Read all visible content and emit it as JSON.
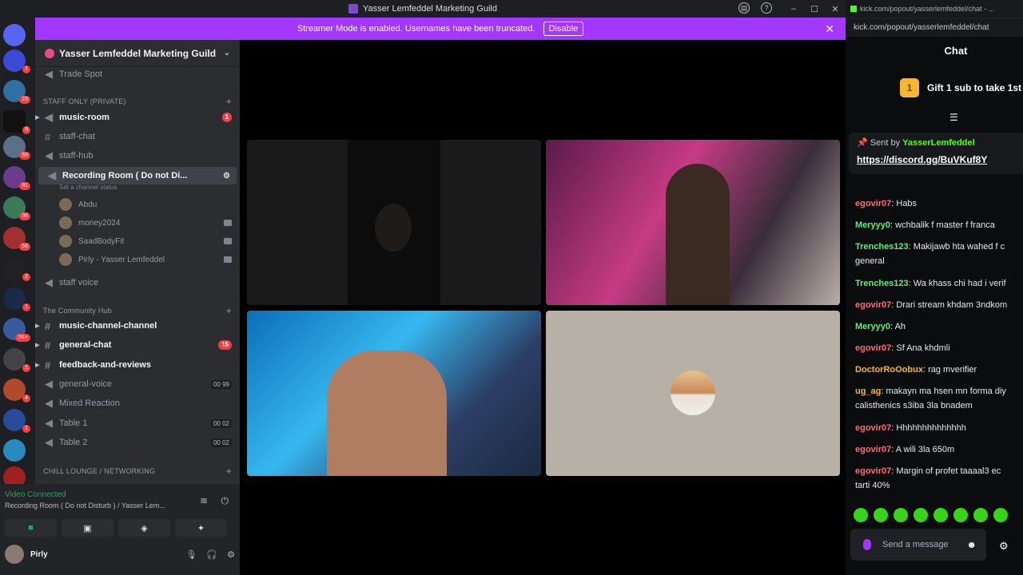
{
  "window": {
    "title": "Yasser Lemfeddel Marketing Guild"
  },
  "banner": {
    "text": "Streamer Mode is enabled. Usernames have been truncated.",
    "button": "Disable"
  },
  "server": {
    "name": "Yasser Lemfeddel Marketing Guild"
  },
  "rail": {
    "badges": [
      "1",
      "23",
      "9",
      "59",
      "91",
      "36",
      "58",
      "2",
      "1",
      "3K+",
      "1",
      "4",
      "1"
    ]
  },
  "channels": {
    "trade": "Trade Spot",
    "cat_staff": "STAFF ONLY (PRIVATE)",
    "music_room": "music-room",
    "music_room_badge": "1",
    "staff_chat": "staff-chat",
    "staff_hub": "staff-hub",
    "recording": "Recording Room ( Do not Di...",
    "status": "Set a channel status",
    "voice_users": [
      "Abdu",
      "money2024",
      "SaadBodyFit",
      "Pirly - Yasser Lemfeddel"
    ],
    "staff_voice": "staff voice",
    "cat_community": "The Community Hub",
    "music_channel": "music-channel-channel",
    "general_chat": "general-chat",
    "general_badge": "15",
    "feedback": "feedback-and-reviews",
    "general_voice": "general-voice",
    "general_voice_count": "00 99",
    "mixed": "Mixed Reaction",
    "table1": "Table 1",
    "table1_count": "00 02",
    "table2": "Table 2",
    "table2_count": "00 02",
    "cat_chill": "CHILL LOUNGE / NETWORKING"
  },
  "voice": {
    "status": "Video Connected",
    "channel": "Recording Room ( Do not Disturb ) / Yasser Lem...",
    "user": "Pirly"
  },
  "chat": {
    "tab_url": "kick.com/popout/yasserlemfeddel/chat - ...",
    "url": "kick.com/popout/yasserlemfeddel/chat",
    "title": "Chat",
    "gift": "Gift 1 sub to take 1st",
    "gift_rank": "1",
    "pinned_label": "Sent by",
    "pinned_user": "YasserLemfeddel",
    "pinned_link": "https://discord.gg/BuVKuf8Y",
    "messages": [
      {
        "user": "egovir07",
        "text": "Habs",
        "color": "#ff6b7b"
      },
      {
        "user": "Meryyy0",
        "text": "wchbalik f master f franca",
        "color": "#5cf07a"
      },
      {
        "user": "Trenches123",
        "text": "Makijawb hta wahed f c",
        "text2": "general",
        "color": "#5cf07a"
      },
      {
        "user": "Trenches123",
        "text": "Wa khass chi had i verif",
        "color": "#5cf07a"
      },
      {
        "user": "egovir07",
        "text": "Drari stream khdam 3ndkom",
        "color": "#ff6b7b"
      },
      {
        "user": "Meryyy0",
        "text": "Ah",
        "color": "#5cf07a"
      },
      {
        "user": "egovir07",
        "text": "Sf Ana khdmli",
        "color": "#ff6b7b"
      },
      {
        "user": "DoctorRoOobux",
        "text": "rag mverifier",
        "color": "#f5b731"
      },
      {
        "user": "ug_ag",
        "text": "makayn ma hsen mn forma diy",
        "text2": "calisthenics s3iba 3la bnadem",
        "color": "#f5b731"
      },
      {
        "user": "egovir07",
        "text": "Hhhhhhhhhhhhhh",
        "color": "#ff6b7b"
      },
      {
        "user": "egovir07",
        "text": "A wili 3la 650m",
        "color": "#ff6b7b"
      },
      {
        "user": "egovir07",
        "text": "Margin of profet taaaal3 ec",
        "text2": "tarti 40%",
        "color": "#ff6b7b"
      }
    ],
    "input_placeholder": "Send a message"
  }
}
